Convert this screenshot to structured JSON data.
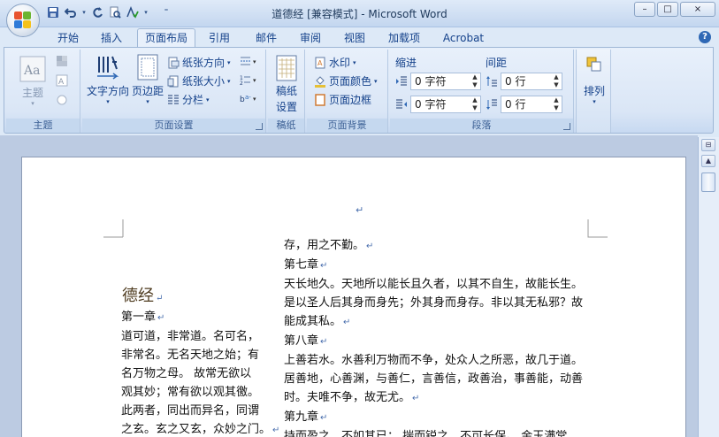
{
  "window": {
    "title": "道德经 [兼容模式] - Microsoft Word",
    "controls": [
      "–",
      "□",
      "×"
    ]
  },
  "qat": [
    "save-icon",
    "undo-icon",
    "redo-icon",
    "print-preview-icon",
    "spell-icon"
  ],
  "tabs": [
    "开始",
    "插入",
    "页面布局",
    "引用",
    "邮件",
    "审阅",
    "视图",
    "加载项",
    "Acrobat"
  ],
  "active_tab": "页面布局",
  "ribbon": {
    "theme": {
      "label": "主题",
      "group": "主题"
    },
    "page_setup": {
      "text_direction": "文字方向",
      "margins": "页边距",
      "orientation": "纸张方向",
      "size": "纸张大小",
      "columns": "分栏",
      "group": "页面设置"
    },
    "manuscript": {
      "label_line1": "稿纸",
      "label_line2": "设置",
      "group": "稿纸"
    },
    "page_background": {
      "watermark": "水印",
      "page_color": "页面颜色",
      "page_borders": "页面边框",
      "group": "页面背景"
    },
    "paragraph": {
      "indent_label": "缩进",
      "spacing_label": "间距",
      "indent_left": "0 字符",
      "indent_right": "0 字符",
      "spacing_before": "0 行",
      "spacing_after": "0 行",
      "group": "段落"
    },
    "arrange": {
      "label": "排列"
    }
  },
  "document": {
    "title": "德经",
    "left_column": [
      "第一章",
      "道可道，非常道。名可名，",
      "非常名。无名天地之始；有",
      "名万物之母。 故常无欲以",
      "观其妙；常有欲以观其徼。",
      "此两者，同出而异名，同谓",
      "之玄。玄之又玄，众妙之门。"
    ],
    "right_column": [
      "存，用之不勤。",
      "第七章",
      "天长地久。天地所以能长且久者，以其不自生，故能长生。",
      "是以圣人后其身而身先；外其身而身存。非以其无私邪？故",
      "能成其私。",
      "第八章",
      "上善若水。水善利万物而不争，处众人之所恶，故几于道。",
      "居善地，心善渊，与善仁，言善信，政善治，事善能，动善",
      "时。夫唯不争，故无尤。",
      "第九章",
      "持而盈之，不如其已； 揣而锐之，不可长保。 金玉满堂，"
    ]
  }
}
